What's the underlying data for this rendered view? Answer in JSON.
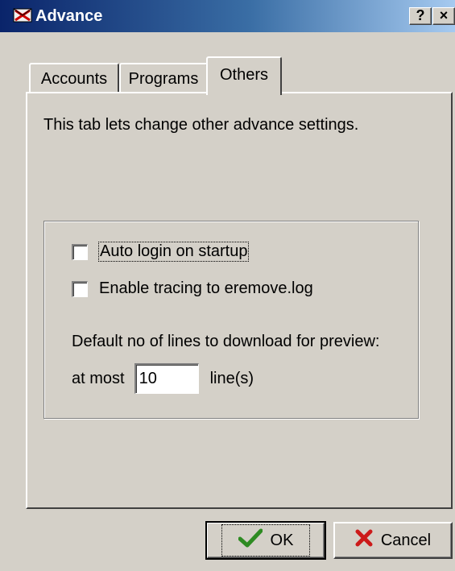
{
  "window": {
    "title": "Advance",
    "help_label": "?",
    "close_label": "×"
  },
  "tabs": [
    {
      "label": "Accounts",
      "selected": false
    },
    {
      "label": "Programs",
      "selected": false
    },
    {
      "label": "Others",
      "selected": true
    }
  ],
  "panel": {
    "description": "This tab lets change other advance settings.",
    "auto_login": {
      "label": "Auto login on startup",
      "checked": false
    },
    "tracing": {
      "label": "Enable tracing to eremove.log",
      "checked": false
    },
    "preview_label": "Default no of lines to download for preview:",
    "at_most_label": "at most",
    "lines_value": "10",
    "lines_unit": "line(s)"
  },
  "buttons": {
    "ok_label": "OK",
    "cancel_label": "Cancel"
  },
  "icons": {
    "app": "app-icon",
    "ok": "checkmark-icon",
    "cancel": "red-x-icon"
  },
  "colors": {
    "titlebar_start": "#0a246a",
    "titlebar_end": "#a6caf0",
    "face": "#d4d0c8",
    "ok_icon": "#2e8b22",
    "cancel_icon": "#cc1a1a"
  }
}
